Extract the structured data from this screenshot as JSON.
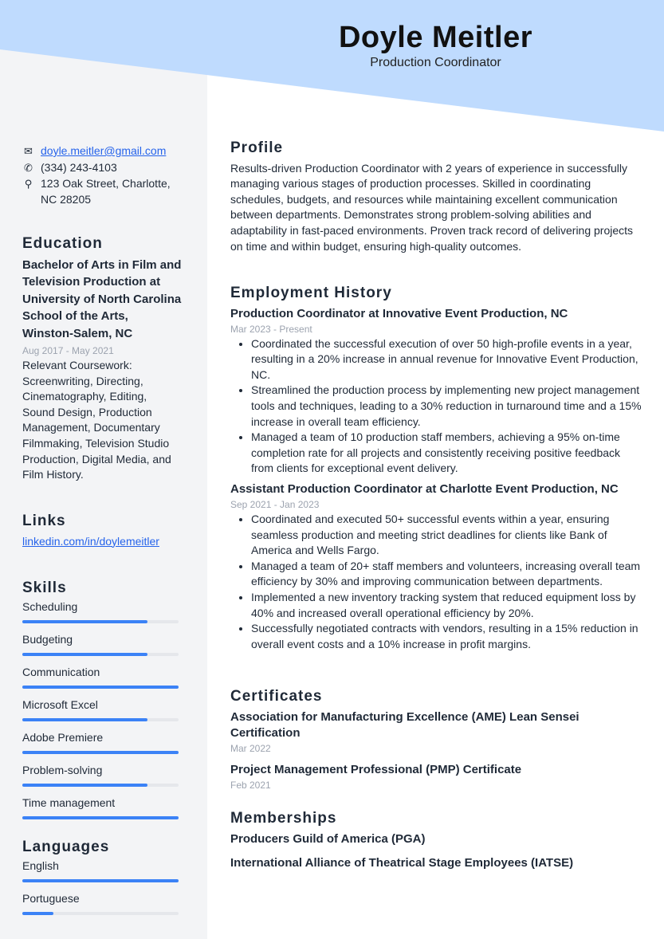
{
  "header": {
    "name": "Doyle Meitler",
    "title": "Production Coordinator"
  },
  "colors": {
    "header_band": "#bfdbfe",
    "sidebar": "#f3f4f6",
    "accent": "#3b82f6"
  },
  "contact": {
    "email": "doyle.meitler@gmail.com",
    "phone": "(334) 243-4103",
    "address": "123 Oak Street, Charlotte, NC 28205"
  },
  "education": {
    "heading": "Education",
    "degree": "Bachelor of Arts in Film and Television Production at University of North Carolina School of the Arts, Winston-Salem, NC",
    "dates": "Aug 2017 - May 2021",
    "coursework": "Relevant Coursework: Screenwriting, Directing, Cinematography, Editing, Sound Design, Production Management, Documentary Filmmaking, Television Studio Production, Digital Media, and Film History."
  },
  "links": {
    "heading": "Links",
    "linkedin": "linkedin.com/in/doylemeitler"
  },
  "skills": {
    "heading": "Skills",
    "items": [
      {
        "label": "Scheduling",
        "level": 80
      },
      {
        "label": "Budgeting",
        "level": 80
      },
      {
        "label": "Communication",
        "level": 100
      },
      {
        "label": "Microsoft Excel",
        "level": 80
      },
      {
        "label": "Adobe Premiere",
        "level": 100
      },
      {
        "label": "Problem-solving",
        "level": 80
      },
      {
        "label": "Time management",
        "level": 100
      }
    ]
  },
  "languages": {
    "heading": "Languages",
    "items": [
      {
        "label": "English",
        "level": 100
      },
      {
        "label": "Portuguese",
        "level": 20
      }
    ]
  },
  "profile": {
    "heading": "Profile",
    "text": "Results-driven Production Coordinator with 2 years of experience in successfully managing various stages of production processes. Skilled in coordinating schedules, budgets, and resources while maintaining excellent communication between departments. Demonstrates strong problem-solving abilities and adaptability in fast-paced environments. Proven track record of delivering projects on time and within budget, ensuring high-quality outcomes."
  },
  "employment": {
    "heading": "Employment History",
    "jobs": [
      {
        "title": "Production Coordinator at Innovative Event Production, NC",
        "dates": "Mar 2023 - Present",
        "bullets": [
          "Coordinated the successful execution of over 50 high-profile events in a year, resulting in a 20% increase in annual revenue for Innovative Event Production, NC.",
          "Streamlined the production process by implementing new project management tools and techniques, leading to a 30% reduction in turnaround time and a 15% increase in overall team efficiency.",
          "Managed a team of 10 production staff members, achieving a 95% on-time completion rate for all projects and consistently receiving positive feedback from clients for exceptional event delivery."
        ]
      },
      {
        "title": "Assistant Production Coordinator at Charlotte Event Production, NC",
        "dates": "Sep 2021 - Jan 2023",
        "bullets": [
          "Coordinated and executed 50+ successful events within a year, ensuring seamless production and meeting strict deadlines for clients like Bank of America and Wells Fargo.",
          "Managed a team of 20+ staff members and volunteers, increasing overall team efficiency by 30% and improving communication between departments.",
          "Implemented a new inventory tracking system that reduced equipment loss by 40% and increased overall operational efficiency by 20%.",
          "Successfully negotiated contracts with vendors, resulting in a 15% reduction in overall event costs and a 10% increase in profit margins."
        ]
      }
    ]
  },
  "certificates": {
    "heading": "Certificates",
    "items": [
      {
        "title": "Association for Manufacturing Excellence (AME) Lean Sensei Certification",
        "date": "Mar 2022"
      },
      {
        "title": "Project Management Professional (PMP) Certificate",
        "date": "Feb 2021"
      }
    ]
  },
  "memberships": {
    "heading": "Memberships",
    "items": [
      "Producers Guild of America (PGA)",
      "International Alliance of Theatrical Stage Employees (IATSE)"
    ]
  }
}
